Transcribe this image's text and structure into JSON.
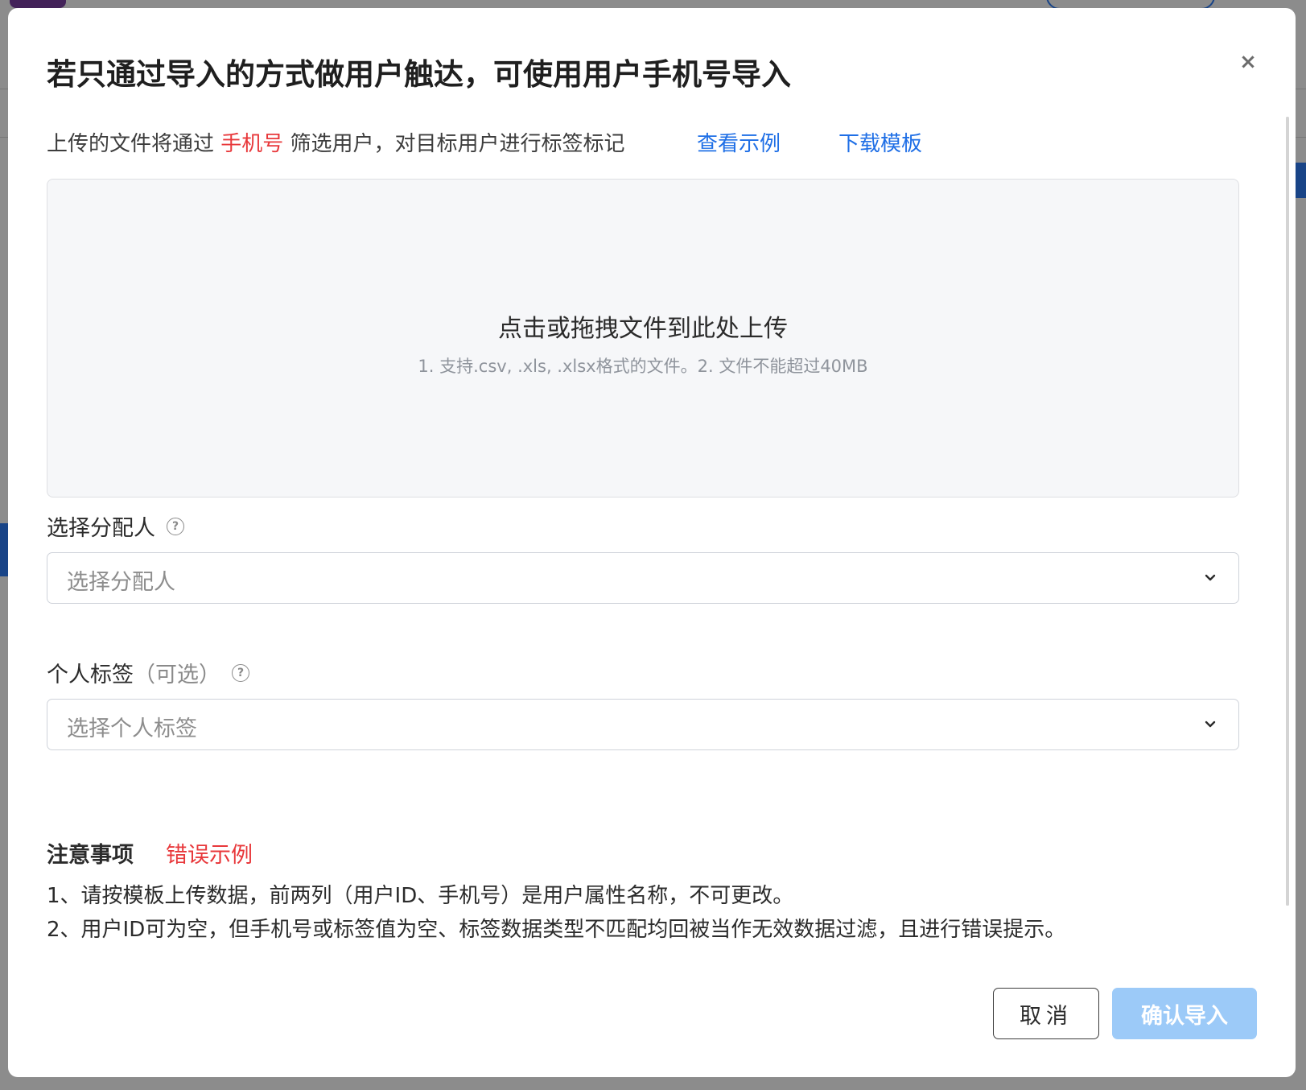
{
  "modal": {
    "title": "若只通过导入的方式做用户触达，可使用用户手机号导入",
    "close_icon": "×"
  },
  "intro": {
    "prefix": "上传的文件将通过 ",
    "highlight": "手机号",
    "suffix": " 筛选用户，对目标用户进行标签标记",
    "view_example_link": "查看示例",
    "download_template_link": "下载模板"
  },
  "upload": {
    "title": "点击或拖拽文件到此处上传",
    "hint": "1. 支持.csv, .xls, .xlsx格式的文件。2. 文件不能超过40MB"
  },
  "assignee": {
    "label": "选择分配人",
    "help_icon": "?",
    "placeholder": "选择分配人"
  },
  "personal_tag": {
    "label": "个人标签",
    "label_suffix": "（可选）",
    "help_icon": "?",
    "placeholder": "选择个人标签"
  },
  "notes": {
    "heading": "注意事项",
    "error_example_link": "错误示例",
    "lines": [
      "1、请按模板上传数据，前两列（用户ID、手机号）是用户属性名称，不可更改。",
      "2、用户ID可为空，但手机号或标签值为空、标签数据类型不匹配均回被当作无效数据过滤，且进行错误提示。"
    ]
  },
  "footer": {
    "cancel_label": "取消",
    "confirm_label": "确认导入"
  },
  "colors": {
    "link": "#1f6fe6",
    "highlight_red": "#e8383b",
    "confirm_disabled": "#9ccaf8",
    "upload_bg": "#f6f7f9"
  }
}
